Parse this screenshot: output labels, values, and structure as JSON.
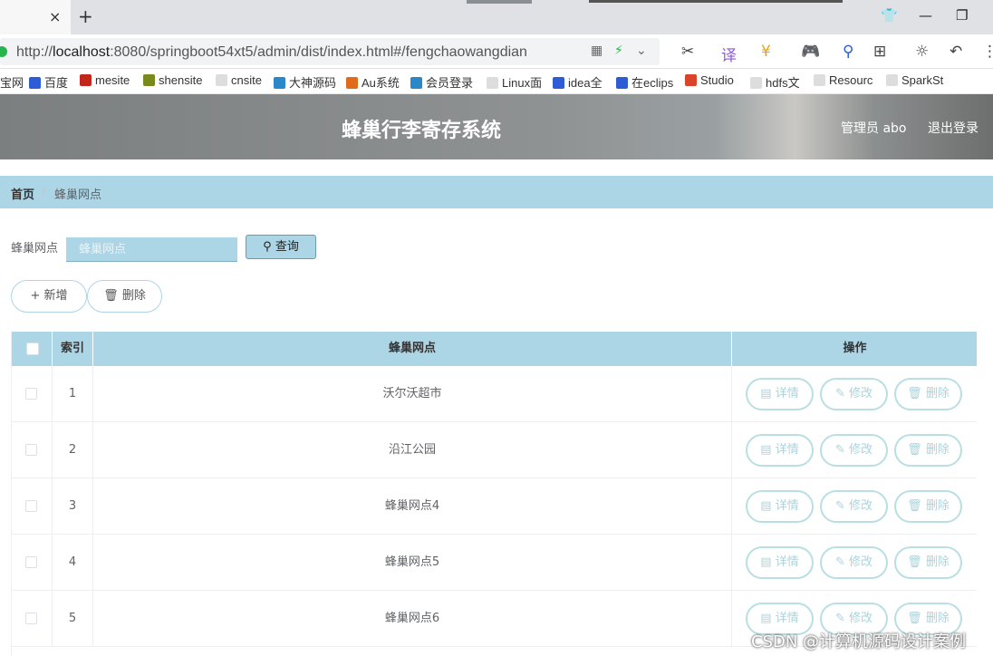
{
  "browser": {
    "url_prefix": "http://",
    "url_host": "localhost",
    "url_rest": ":8080/springboot54xt5/admin/dist/index.html#/fengchaowangdian",
    "new_tab": "+",
    "close_tab": "×"
  },
  "bookmarks": [
    {
      "label": "宝网",
      "color": "#ff6a00"
    },
    {
      "label": "百度",
      "color": "#2e5bd6"
    },
    {
      "label": "mesite",
      "color": "#c3261b"
    },
    {
      "label": "shensite",
      "color": "#7a8a1a"
    },
    {
      "label": "cnsite",
      "color": "#999999"
    },
    {
      "label": "大神源码",
      "color": "#2a87c8"
    },
    {
      "label": "Au系统",
      "color": "#e06b1a"
    },
    {
      "label": "会员登录",
      "color": "#2a87c8"
    },
    {
      "label": "Linux面",
      "color": "#999999"
    },
    {
      "label": "idea全",
      "color": "#2e5bd6"
    },
    {
      "label": "在eclips",
      "color": "#2e5bd6"
    },
    {
      "label": "Studio",
      "color": "#d9442b"
    },
    {
      "label": "hdfs文",
      "color": "#999999"
    },
    {
      "label": "Resourc",
      "color": "#999999"
    },
    {
      "label": "SparkSt",
      "color": "#999999"
    }
  ],
  "header": {
    "title": "蜂巢行李寄存系统",
    "user": "管理员 abo",
    "logout": "退出登录"
  },
  "breadcrumb": {
    "home": "首页",
    "separator": "/",
    "current": "蜂巢网点"
  },
  "search": {
    "label": "蜂巢网点",
    "placeholder": "蜂巢网点",
    "button": "查询"
  },
  "actions": {
    "add": "新增",
    "delete": "删除"
  },
  "table": {
    "headers": {
      "index": "索引",
      "name": "蜂巢网点",
      "ops": "操作"
    },
    "ops": {
      "detail": "详情",
      "edit": "修改",
      "delete": "删除"
    },
    "rows": [
      {
        "index": "1",
        "name": "沃尔沃超市"
      },
      {
        "index": "2",
        "name": "沿江公园"
      },
      {
        "index": "3",
        "name": "蜂巢网点4"
      },
      {
        "index": "4",
        "name": "蜂巢网点5"
      },
      {
        "index": "5",
        "name": "蜂巢网点6"
      }
    ]
  },
  "watermark": "CSDN @计算机源码设计案例",
  "colors": {
    "accent": "#acd5e6",
    "op_border": "#b9dfe3"
  }
}
